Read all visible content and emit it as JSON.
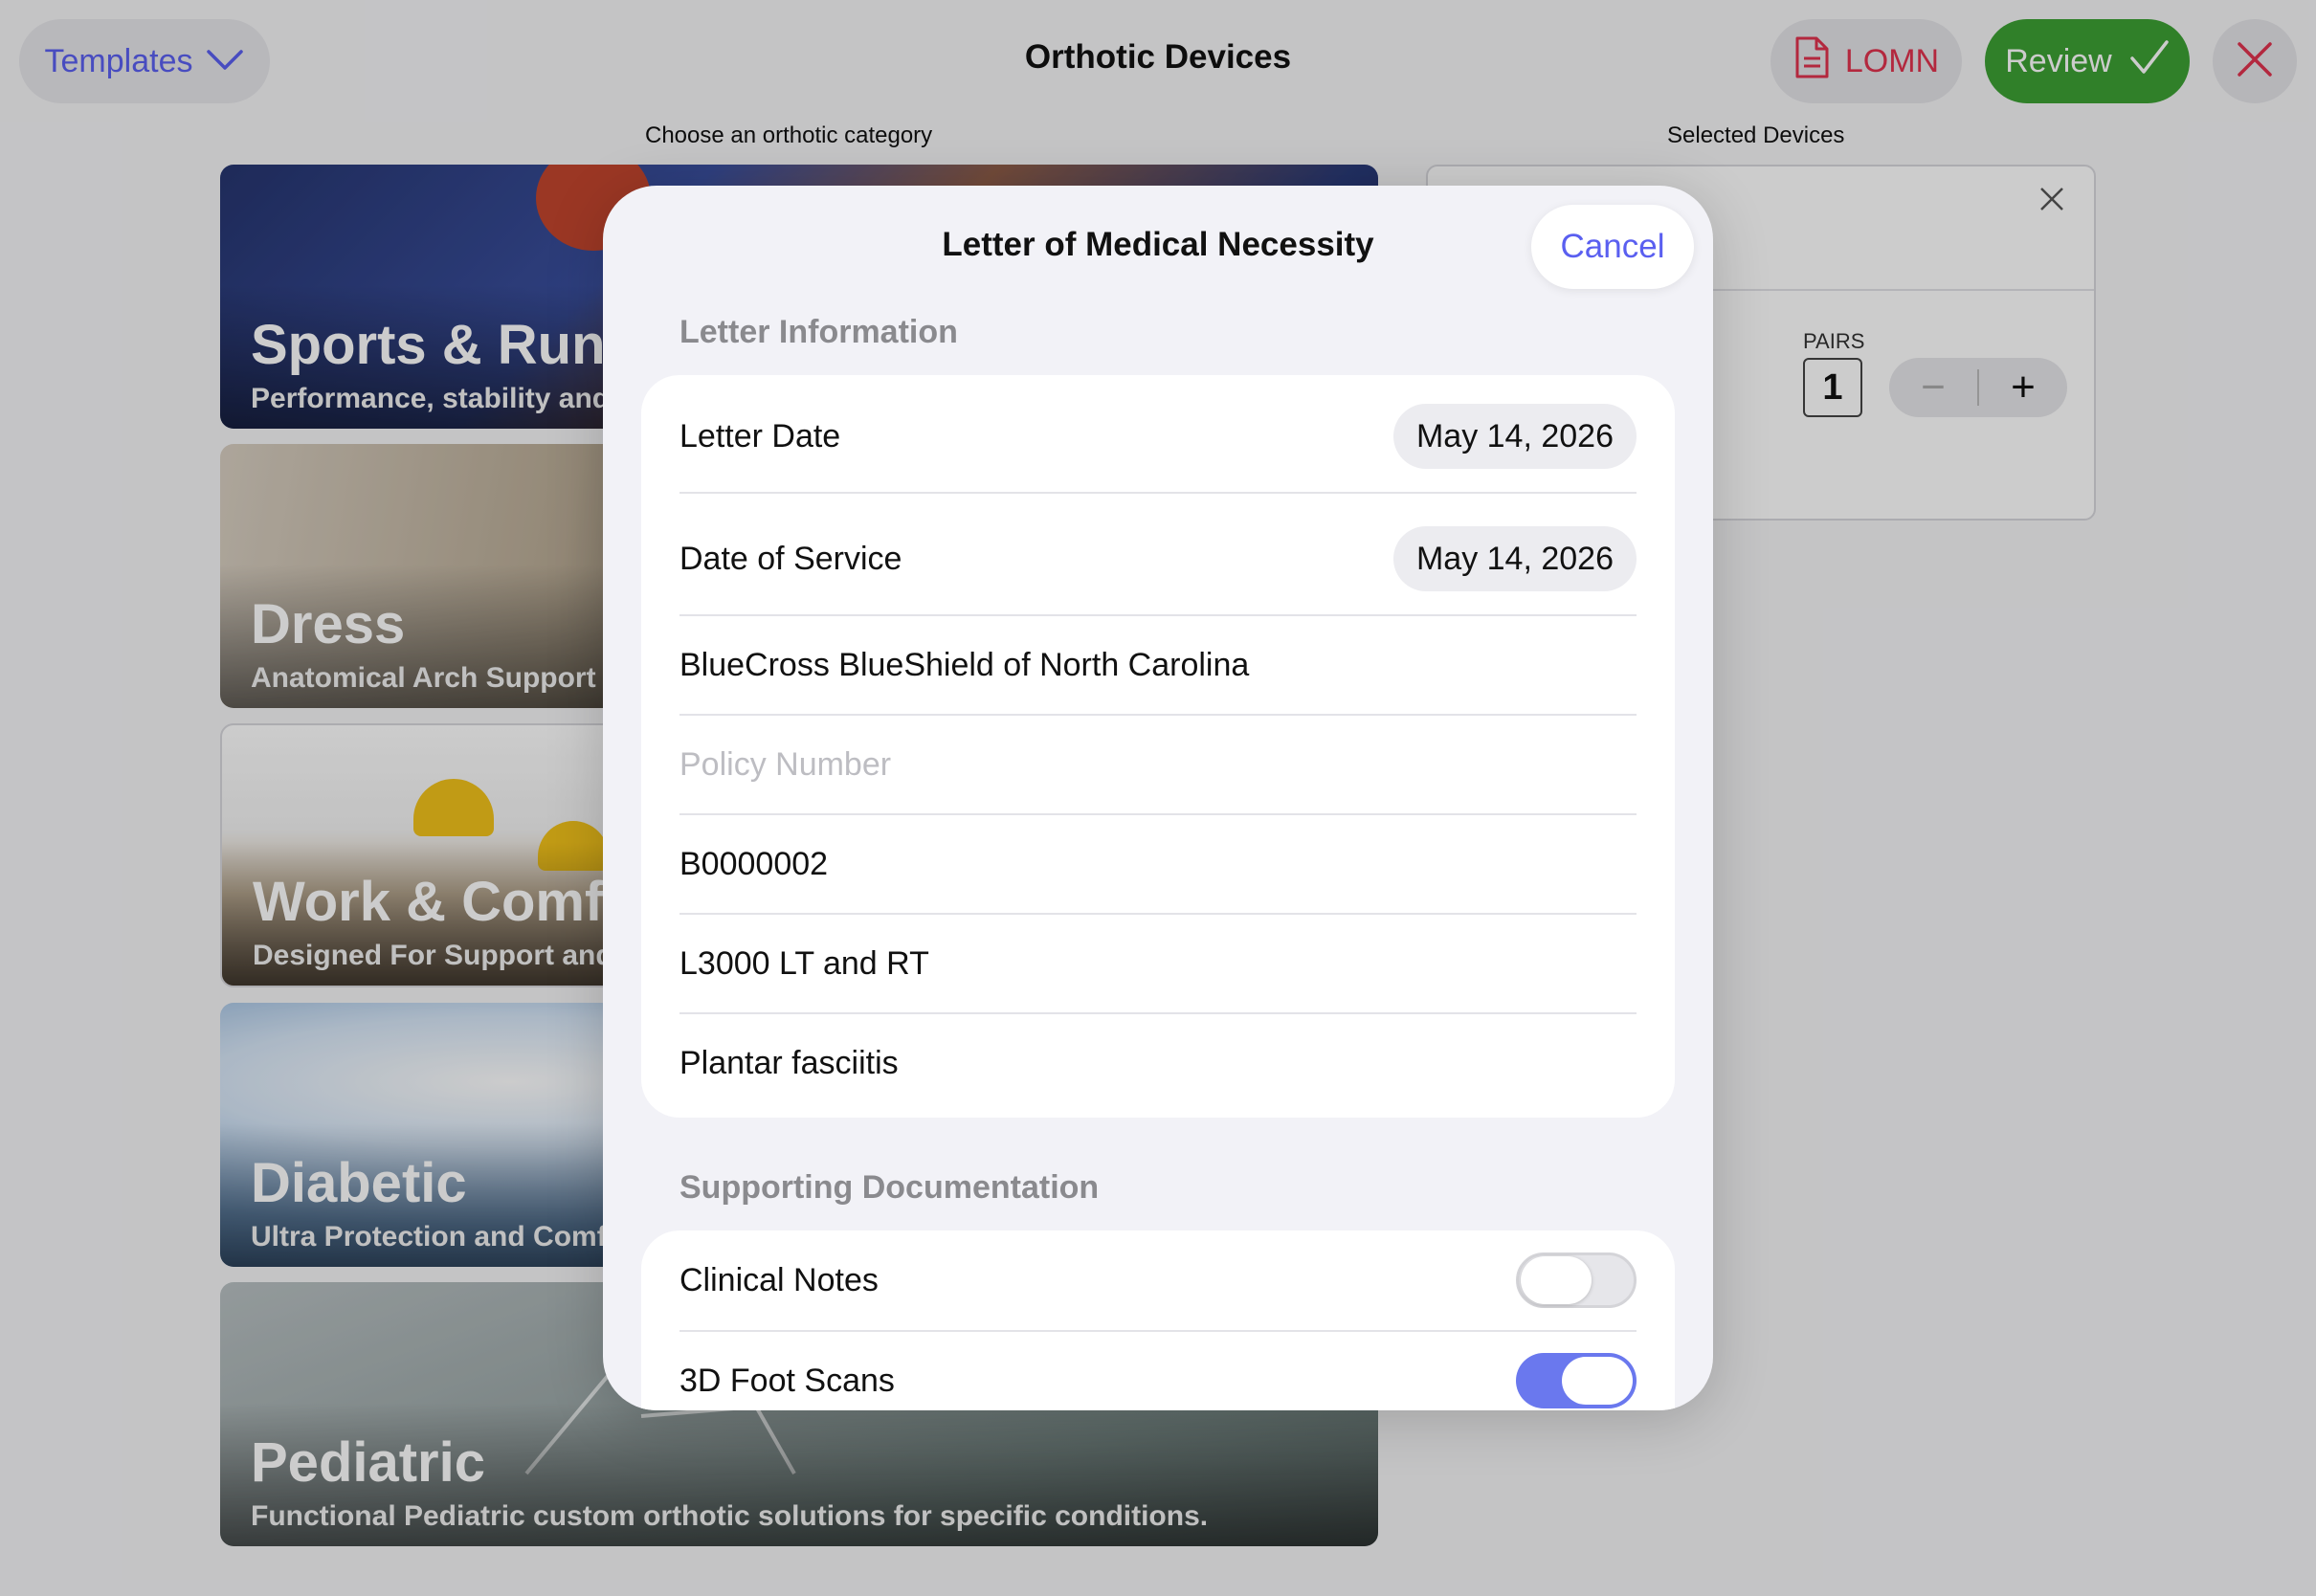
{
  "topbar": {
    "templates_label": "Templates",
    "title": "Orthotic Devices",
    "lomn_label": "LOMN",
    "review_label": "Review"
  },
  "left_column_label": "Choose an orthotic category",
  "right_column_label": "Selected Devices",
  "categories": [
    {
      "title": "Sports & Runn",
      "subtitle": "Performance, stability and"
    },
    {
      "title": "Dress",
      "subtitle": "Anatomical Arch Support"
    },
    {
      "title": "Work & Comfo",
      "subtitle": "Designed For Support and"
    },
    {
      "title": "Diabetic",
      "subtitle": "Ultra Protection and Comf"
    },
    {
      "title": "Pediatric",
      "subtitle": "Functional Pediatric custom orthotic solutions for specific conditions."
    }
  ],
  "selected": {
    "pairs_label": "PAIRS",
    "pairs_value": "1",
    "minus": "−",
    "plus": "+"
  },
  "modal": {
    "title": "Letter of Medical Necessity",
    "cancel_label": "Cancel",
    "letter_section": "Letter Information",
    "letter_date_label": "Letter Date",
    "letter_date_value": "May 14, 2026",
    "service_date_label": "Date of Service",
    "service_date_value": "May 14, 2026",
    "insurer": "BlueCross BlueShield of North Carolina",
    "policy_placeholder": "Policy Number",
    "member_id": "B0000002",
    "code": "L3000 LT and RT",
    "diagnosis": "Plantar fasciitis",
    "support_section": "Supporting Documentation",
    "clinical_notes_label": "Clinical Notes",
    "clinical_notes_on": false,
    "foot_scans_label": "3D Foot Scans",
    "foot_scans_on": true
  },
  "colors": {
    "accent": "#5a5ff0",
    "review_green": "#3ca034",
    "lomn_red": "#e0334e",
    "toggle_on": "#6a78ee"
  },
  "icons": {
    "templates": "chevron-down-icon",
    "lomn": "document-icon",
    "review": "checkmark-icon",
    "close": "close-icon"
  }
}
